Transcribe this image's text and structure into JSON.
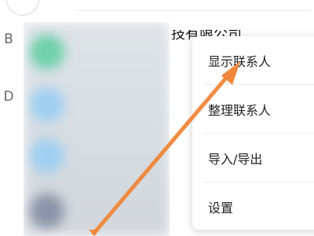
{
  "index_letters": [
    "B",
    "D"
  ],
  "contact": {
    "name_fragment": "技有限公司"
  },
  "menu": {
    "items": [
      {
        "label": "显示联系人"
      },
      {
        "label": "整理联系人"
      },
      {
        "label": "导入/导出"
      },
      {
        "label": "设置"
      }
    ]
  },
  "colors": {
    "annotation_arrow": "#f0873a",
    "menu_bg": "#ffffff",
    "index_letter": "#666666"
  }
}
